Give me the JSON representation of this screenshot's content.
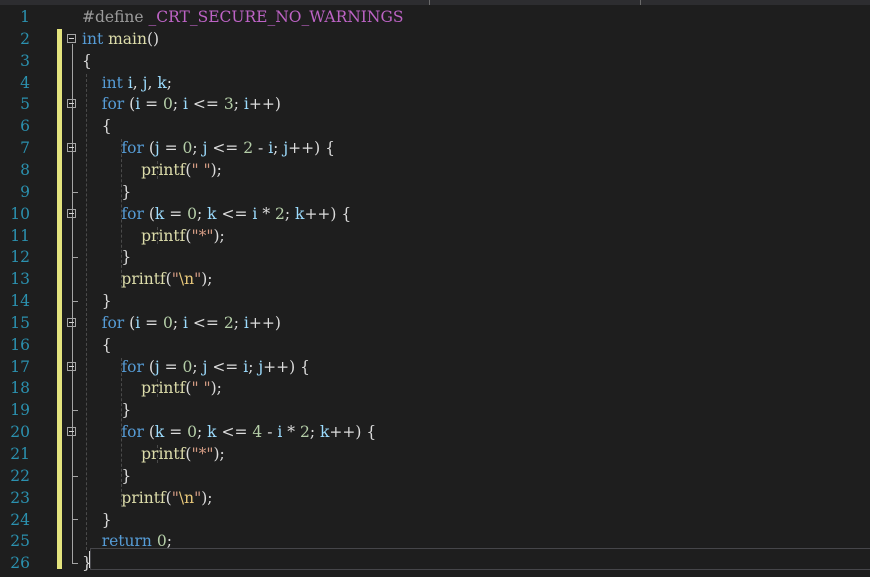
{
  "editor": {
    "line_numbers": [
      "1",
      "2",
      "3",
      "4",
      "5",
      "6",
      "7",
      "8",
      "9",
      "10",
      "11",
      "12",
      "13",
      "14",
      "15",
      "16",
      "17",
      "18",
      "19",
      "20",
      "21",
      "22",
      "23",
      "24",
      "25",
      "26"
    ],
    "lines": [
      {
        "tokens": [
          [
            "pp",
            "#define "
          ],
          [
            "macro",
            "_CRT_SECURE_NO_WARNINGS"
          ]
        ]
      },
      {
        "tokens": [
          [
            "kw",
            "int"
          ],
          [
            "t",
            " "
          ],
          [
            "fn",
            "main"
          ],
          [
            "t",
            "()"
          ]
        ]
      },
      {
        "tokens": [
          [
            "t",
            "{"
          ]
        ]
      },
      {
        "tokens": [
          [
            "t",
            "    "
          ],
          [
            "kw",
            "int"
          ],
          [
            "t",
            " "
          ],
          [
            "var",
            "i"
          ],
          [
            "t",
            ", "
          ],
          [
            "var",
            "j"
          ],
          [
            "t",
            ", "
          ],
          [
            "var",
            "k"
          ],
          [
            "t",
            ";"
          ]
        ]
      },
      {
        "tokens": [
          [
            "t",
            "    "
          ],
          [
            "kw",
            "for"
          ],
          [
            "t",
            " ("
          ],
          [
            "var",
            "i"
          ],
          [
            "t",
            " = "
          ],
          [
            "num",
            "0"
          ],
          [
            "t",
            "; "
          ],
          [
            "var",
            "i"
          ],
          [
            "t",
            " <= "
          ],
          [
            "num",
            "3"
          ],
          [
            "t",
            "; "
          ],
          [
            "var",
            "i"
          ],
          [
            "t",
            "++)"
          ]
        ]
      },
      {
        "tokens": [
          [
            "t",
            "    {"
          ]
        ]
      },
      {
        "tokens": [
          [
            "t",
            "        "
          ],
          [
            "kw",
            "for"
          ],
          [
            "t",
            " ("
          ],
          [
            "var",
            "j"
          ],
          [
            "t",
            " = "
          ],
          [
            "num",
            "0"
          ],
          [
            "t",
            "; "
          ],
          [
            "var",
            "j"
          ],
          [
            "t",
            " <= "
          ],
          [
            "num",
            "2"
          ],
          [
            "t",
            " - "
          ],
          [
            "var",
            "i"
          ],
          [
            "t",
            "; "
          ],
          [
            "var",
            "j"
          ],
          [
            "t",
            "++) {"
          ]
        ]
      },
      {
        "tokens": [
          [
            "t",
            "            "
          ],
          [
            "fn",
            "printf"
          ],
          [
            "t",
            "("
          ],
          [
            "str",
            "\" \""
          ],
          [
            "t",
            ");"
          ]
        ]
      },
      {
        "tokens": [
          [
            "t",
            "        }"
          ]
        ]
      },
      {
        "tokens": [
          [
            "t",
            "        "
          ],
          [
            "kw",
            "for"
          ],
          [
            "t",
            " ("
          ],
          [
            "var",
            "k"
          ],
          [
            "t",
            " = "
          ],
          [
            "num",
            "0"
          ],
          [
            "t",
            "; "
          ],
          [
            "var",
            "k"
          ],
          [
            "t",
            " <= "
          ],
          [
            "var",
            "i"
          ],
          [
            "t",
            " * "
          ],
          [
            "num",
            "2"
          ],
          [
            "t",
            "; "
          ],
          [
            "var",
            "k"
          ],
          [
            "t",
            "++) {"
          ]
        ]
      },
      {
        "tokens": [
          [
            "t",
            "            "
          ],
          [
            "fn",
            "printf"
          ],
          [
            "t",
            "("
          ],
          [
            "str",
            "\"*\""
          ],
          [
            "t",
            ");"
          ]
        ]
      },
      {
        "tokens": [
          [
            "t",
            "        }"
          ]
        ]
      },
      {
        "tokens": [
          [
            "t",
            "        "
          ],
          [
            "fn",
            "printf"
          ],
          [
            "t",
            "("
          ],
          [
            "str",
            "\""
          ],
          [
            "esc",
            "\\n"
          ],
          [
            "str",
            "\""
          ],
          [
            "t",
            ");"
          ]
        ]
      },
      {
        "tokens": [
          [
            "t",
            "    }"
          ]
        ]
      },
      {
        "tokens": [
          [
            "t",
            "    "
          ],
          [
            "kw",
            "for"
          ],
          [
            "t",
            " ("
          ],
          [
            "var",
            "i"
          ],
          [
            "t",
            " = "
          ],
          [
            "num",
            "0"
          ],
          [
            "t",
            "; "
          ],
          [
            "var",
            "i"
          ],
          [
            "t",
            " <= "
          ],
          [
            "num",
            "2"
          ],
          [
            "t",
            "; "
          ],
          [
            "var",
            "i"
          ],
          [
            "t",
            "++)"
          ]
        ]
      },
      {
        "tokens": [
          [
            "t",
            "    {"
          ]
        ]
      },
      {
        "tokens": [
          [
            "t",
            "        "
          ],
          [
            "kw",
            "for"
          ],
          [
            "t",
            " ("
          ],
          [
            "var",
            "j"
          ],
          [
            "t",
            " = "
          ],
          [
            "num",
            "0"
          ],
          [
            "t",
            "; "
          ],
          [
            "var",
            "j"
          ],
          [
            "t",
            " <= "
          ],
          [
            "var",
            "i"
          ],
          [
            "t",
            "; "
          ],
          [
            "var",
            "j"
          ],
          [
            "t",
            "++) {"
          ]
        ]
      },
      {
        "tokens": [
          [
            "t",
            "            "
          ],
          [
            "fn",
            "printf"
          ],
          [
            "t",
            "("
          ],
          [
            "str",
            "\" \""
          ],
          [
            "t",
            ");"
          ]
        ]
      },
      {
        "tokens": [
          [
            "t",
            "        }"
          ]
        ]
      },
      {
        "tokens": [
          [
            "t",
            "        "
          ],
          [
            "kw",
            "for"
          ],
          [
            "t",
            " ("
          ],
          [
            "var",
            "k"
          ],
          [
            "t",
            " = "
          ],
          [
            "num",
            "0"
          ],
          [
            "t",
            "; "
          ],
          [
            "var",
            "k"
          ],
          [
            "t",
            " <= "
          ],
          [
            "num",
            "4"
          ],
          [
            "t",
            " - "
          ],
          [
            "var",
            "i"
          ],
          [
            "t",
            " * "
          ],
          [
            "num",
            "2"
          ],
          [
            "t",
            "; "
          ],
          [
            "var",
            "k"
          ],
          [
            "t",
            "++) {"
          ]
        ]
      },
      {
        "tokens": [
          [
            "t",
            "            "
          ],
          [
            "fn",
            "printf"
          ],
          [
            "t",
            "("
          ],
          [
            "str",
            "\"*\""
          ],
          [
            "t",
            ");"
          ]
        ]
      },
      {
        "tokens": [
          [
            "t",
            "        }"
          ]
        ]
      },
      {
        "tokens": [
          [
            "t",
            "        "
          ],
          [
            "fn",
            "printf"
          ],
          [
            "t",
            "("
          ],
          [
            "str",
            "\""
          ],
          [
            "esc",
            "\\n"
          ],
          [
            "str",
            "\""
          ],
          [
            "t",
            ");"
          ]
        ]
      },
      {
        "tokens": [
          [
            "t",
            "    }"
          ]
        ]
      },
      {
        "tokens": [
          [
            "t",
            "    "
          ],
          [
            "kw",
            "return"
          ],
          [
            "t",
            " "
          ],
          [
            "num",
            "0"
          ],
          [
            "t",
            ";"
          ]
        ]
      },
      {
        "tokens": [
          [
            "t",
            "}"
          ]
        ]
      }
    ],
    "fold_marker_lines": [
      2,
      5,
      7,
      10,
      15,
      17,
      20
    ],
    "colors": {
      "background": "#1e1e1e",
      "line_number": "#2b91af",
      "keyword": "#569cd6",
      "function": "#dcdcaa",
      "variable": "#9cdcfe",
      "number": "#b5cea8",
      "string": "#d69d85",
      "change_bar": "#e4e47e"
    }
  }
}
